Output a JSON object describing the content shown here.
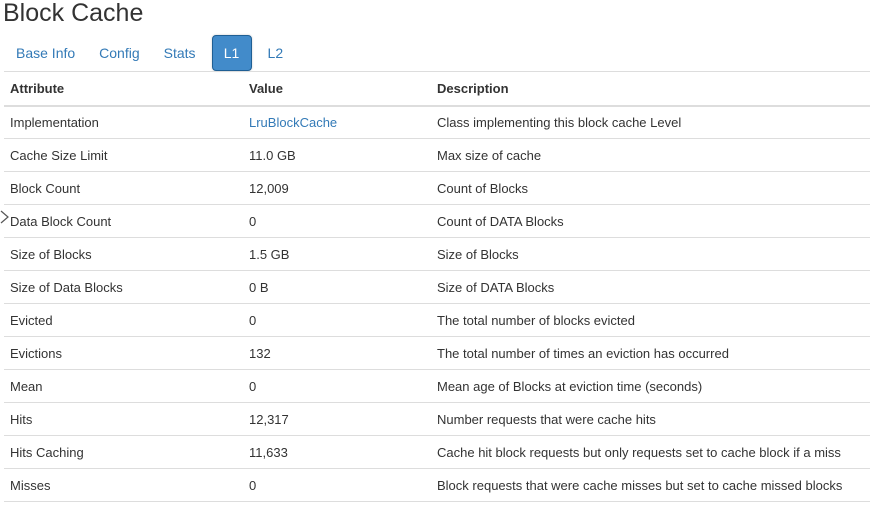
{
  "page": {
    "title": "Block Cache"
  },
  "tabs": [
    {
      "label": "Base Info",
      "active": false
    },
    {
      "label": "Config",
      "active": false
    },
    {
      "label": "Stats",
      "active": false
    },
    {
      "label": "L1",
      "active": true
    },
    {
      "label": "L2",
      "active": false
    }
  ],
  "table": {
    "headers": {
      "attribute": "Attribute",
      "value": "Value",
      "description": "Description"
    },
    "rows": [
      {
        "attribute": "Implementation",
        "value": "LruBlockCache",
        "description": "Class implementing this block cache Level"
      },
      {
        "attribute": "Cache Size Limit",
        "value": "11.0 GB",
        "description": "Max size of cache"
      },
      {
        "attribute": "Block Count",
        "value": "12,009",
        "description": "Count of Blocks"
      },
      {
        "attribute": "Data Block Count",
        "value": "0",
        "description": "Count of DATA Blocks"
      },
      {
        "attribute": "Size of Blocks",
        "value": "1.5 GB",
        "description": "Size of Blocks"
      },
      {
        "attribute": "Size of Data Blocks",
        "value": "0 B",
        "description": "Size of DATA Blocks"
      },
      {
        "attribute": "Evicted",
        "value": "0",
        "description": "The total number of blocks evicted"
      },
      {
        "attribute": "Evictions",
        "value": "132",
        "description": "The total number of times an eviction has occurred"
      },
      {
        "attribute": "Mean",
        "value": "0",
        "description": "Mean age of Blocks at eviction time (seconds)"
      },
      {
        "attribute": "Hits",
        "value": "12,317",
        "description": "Number requests that were cache hits"
      },
      {
        "attribute": "Hits Caching",
        "value": "11,633",
        "description": "Cache hit block requests but only requests set to cache block if a miss"
      },
      {
        "attribute": "Misses",
        "value": "0",
        "description": "Block requests that were cache misses but set to cache missed blocks"
      }
    ]
  },
  "colors": {
    "link": "#337ab7",
    "active_tab": "#428bca",
    "border": "#dddddd",
    "text": "#333333"
  },
  "icons": {
    "cursor": "mouse-pointer-icon"
  }
}
